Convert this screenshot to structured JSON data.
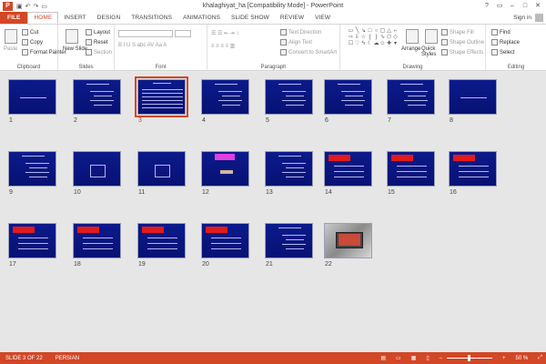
{
  "window": {
    "title": "khalaghiyat_ha [Compatibility Mode] - PowerPoint",
    "app_icon": "P",
    "controls": [
      "?",
      "▭",
      "–",
      "□",
      "✕"
    ]
  },
  "tabs": [
    {
      "label": "FILE"
    },
    {
      "label": "HOME"
    },
    {
      "label": "INSERT"
    },
    {
      "label": "DESIGN"
    },
    {
      "label": "TRANSITIONS"
    },
    {
      "label": "ANIMATIONS"
    },
    {
      "label": "SLIDE SHOW"
    },
    {
      "label": "REVIEW"
    },
    {
      "label": "VIEW"
    }
  ],
  "active_tab": "HOME",
  "signin": "Sign in",
  "ribbon": {
    "clipboard": {
      "label": "Clipboard",
      "paste": "Paste",
      "cut": "Cut",
      "copy": "Copy",
      "format_painter": "Format Painter"
    },
    "slides": {
      "label": "Slides",
      "new_slide": "New Slide",
      "layout": "Layout",
      "reset": "Reset",
      "section": "Section"
    },
    "font": {
      "label": "Font"
    },
    "paragraph": {
      "label": "Paragraph",
      "text_direction": "Text Direction",
      "align_text": "Align Text",
      "convert_smartart": "Convert to SmartArt"
    },
    "drawing": {
      "label": "Drawing",
      "arrange": "Arrange",
      "quick_styles": "Quick Styles",
      "shape_fill": "Shape Fill",
      "shape_outline": "Shape Outline",
      "shape_effects": "Shape Effects"
    },
    "editing": {
      "label": "Editing",
      "find": "Find",
      "replace": "Replace",
      "select": "Select"
    }
  },
  "slides": [
    {
      "num": "1",
      "kind": "title"
    },
    {
      "num": "2",
      "kind": "lines"
    },
    {
      "num": "3",
      "kind": "dense",
      "selected": true
    },
    {
      "num": "4",
      "kind": "lines"
    },
    {
      "num": "5",
      "kind": "lines"
    },
    {
      "num": "6",
      "kind": "lines"
    },
    {
      "num": "7",
      "kind": "lines"
    },
    {
      "num": "8",
      "kind": "title"
    },
    {
      "num": "9",
      "kind": "lines"
    },
    {
      "num": "10",
      "kind": "cube"
    },
    {
      "num": "11",
      "kind": "cube"
    },
    {
      "num": "12",
      "kind": "pink"
    },
    {
      "num": "13",
      "kind": "lines"
    },
    {
      "num": "14",
      "kind": "banner"
    },
    {
      "num": "15",
      "kind": "banner"
    },
    {
      "num": "16",
      "kind": "banner"
    },
    {
      "num": "17",
      "kind": "banner"
    },
    {
      "num": "18",
      "kind": "banner"
    },
    {
      "num": "19",
      "kind": "banner"
    },
    {
      "num": "20",
      "kind": "banner"
    },
    {
      "num": "21",
      "kind": "lines"
    },
    {
      "num": "22",
      "kind": "photo"
    }
  ],
  "status": {
    "slide_info": "SLIDE 3 OF 22",
    "language": "PERSIAN",
    "zoom": "50 %",
    "zoom_fraction": 0.5
  },
  "colors": {
    "accent": "#d24726",
    "slide_bg": "#0b1a8c"
  }
}
